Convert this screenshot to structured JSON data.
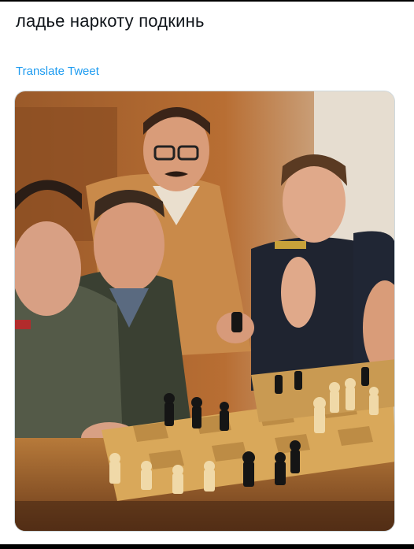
{
  "tweet": {
    "text": "ладье наркоту подкинь",
    "translate_label": "Translate Tweet"
  },
  "media": {
    "type": "photo",
    "subject": "chess-players"
  },
  "colors": {
    "text": "#0f1419",
    "link": "#1d9bf0",
    "border": "#cfd9de",
    "background": "#ffffff"
  }
}
